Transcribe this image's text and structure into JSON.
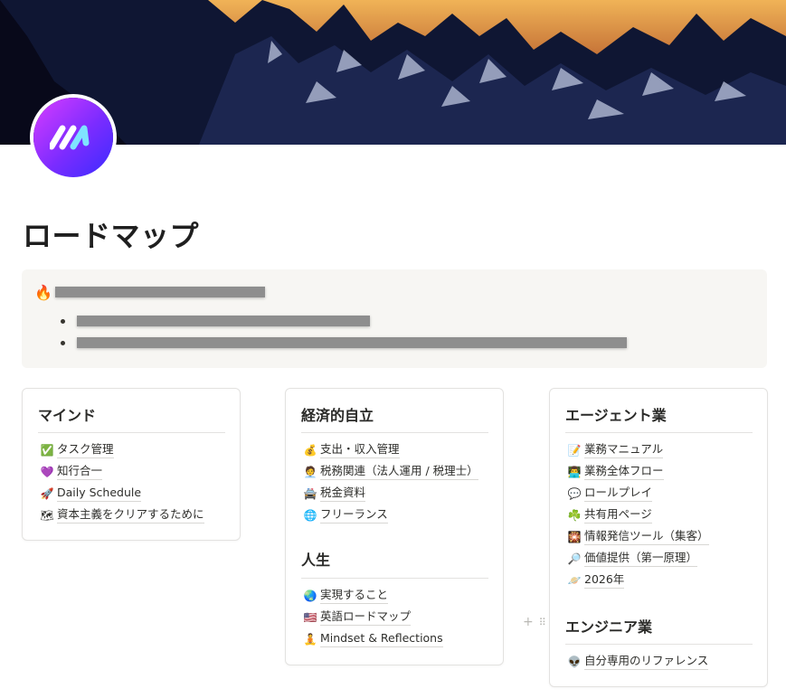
{
  "page": {
    "title": "ロードマップ"
  },
  "callout": {
    "icon": "🔥"
  },
  "cards": {
    "mind": {
      "heading": "マインド",
      "items": [
        {
          "icon": "✅",
          "label": "タスク管理"
        },
        {
          "icon": "💜",
          "label": "知行合一"
        },
        {
          "icon": "🚀",
          "label": "Daily Schedule"
        },
        {
          "icon": "🗺",
          "label": "資本主義をクリアするために"
        }
      ]
    },
    "economic": {
      "heading": "経済的自立",
      "items": [
        {
          "icon": "💰",
          "label": "支出・収入管理"
        },
        {
          "icon": "🧑‍💼",
          "label": "税務関連（法人運用 / 税理士）"
        },
        {
          "icon": "🚔",
          "label": "税金資料"
        },
        {
          "icon": "🌐",
          "label": "フリーランス"
        }
      ]
    },
    "life": {
      "heading": "人生",
      "items": [
        {
          "icon": "🌏",
          "label": "実現すること"
        },
        {
          "icon": "🇺🇸",
          "label": "英語ロードマップ"
        },
        {
          "icon": "🧘",
          "label": "Mindset & Reflections"
        }
      ]
    },
    "agent": {
      "heading": "エージェント業",
      "items": [
        {
          "icon": "📝",
          "label": "業務マニュアル"
        },
        {
          "icon": "👨‍💻",
          "label": "業務全体フロー"
        },
        {
          "icon": "💬",
          "label": "ロールプレイ"
        },
        {
          "icon": "☘️",
          "label": "共有用ページ"
        },
        {
          "icon": "🎇",
          "label": "情報発信ツール（集客）"
        },
        {
          "icon": "🔎",
          "label": "価値提供（第一原理）"
        },
        {
          "icon": "🪐",
          "label": "2026年"
        }
      ]
    },
    "engineer": {
      "heading": "エンジニア業",
      "items": [
        {
          "icon": "👽",
          "label": "自分専用のリファレンス"
        }
      ]
    }
  },
  "block_handle": {
    "plus_icon": "+",
    "drag_icon": "⠿"
  },
  "colors": {
    "logo_gradient_start": "#d93cff",
    "logo_gradient_end": "#3a2bff",
    "callout_bg": "#f7f6f3",
    "card_border": "#e3e2e0"
  }
}
